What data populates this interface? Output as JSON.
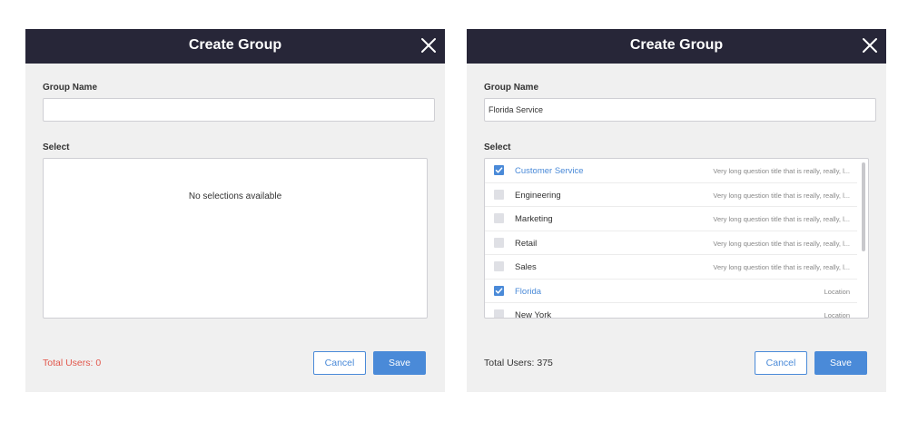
{
  "dialogs": [
    {
      "title": "Create Group",
      "group_name_label": "Group Name",
      "group_name_value": "",
      "select_label": "Select",
      "empty_message": "No selections available",
      "total_users": "Total Users: 0",
      "cancel_label": "Cancel",
      "save_label": "Save"
    },
    {
      "title": "Create Group",
      "group_name_label": "Group Name",
      "group_name_value": "Florida Service",
      "select_label": "Select",
      "items": [
        {
          "name": "Customer Service",
          "desc": "Very long question title that is really, really, l...",
          "checked": true
        },
        {
          "name": "Engineering",
          "desc": "Very long question title that is really, really, l...",
          "checked": false
        },
        {
          "name": "Marketing",
          "desc": "Very long question title that is really, really, l...",
          "checked": false
        },
        {
          "name": "Retail",
          "desc": "Very long question title that is really, really, l...",
          "checked": false
        },
        {
          "name": "Sales",
          "desc": "Very long question title that is really, really, l...",
          "checked": false
        },
        {
          "name": "Florida",
          "desc": "Location",
          "checked": true
        },
        {
          "name": "New York",
          "desc": "Location",
          "checked": false
        }
      ],
      "total_users": "Total Users: 375",
      "cancel_label": "Cancel",
      "save_label": "Save"
    }
  ],
  "icons": {
    "close": "close-icon",
    "check": "checkmark-icon"
  },
  "colors": {
    "header": "#272638",
    "accent": "#4a8ad8",
    "warning": "#e2574c",
    "panel": "#f0f0f0"
  }
}
